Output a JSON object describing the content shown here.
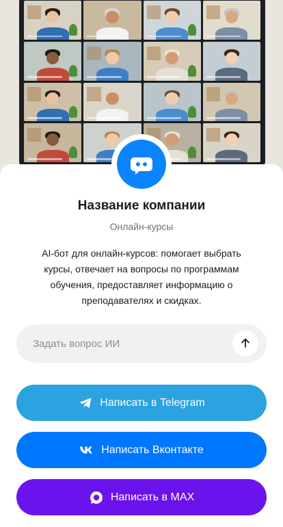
{
  "company": {
    "name": "Название компании",
    "category": "Онлайн-курсы",
    "description": "AI-бот для онлайн-курсов: помогает выбрать курсы, отвечает на вопросы по программам обучения, предоставляет информацию о преподавателях и скидках.",
    "avatar_icon": "chat-bot-icon",
    "avatar_color": "#0a84ff"
  },
  "hero": {
    "image": "video-conference-grid-photo",
    "tiles": 16
  },
  "ask": {
    "placeholder": "Задать вопрос ИИ",
    "value": "",
    "send_icon": "arrow-up-icon"
  },
  "buttons": {
    "telegram": {
      "label": "Написать в Telegram",
      "icon": "telegram-icon",
      "color": "#2aa3e0"
    },
    "vk": {
      "label": "Написать Вконтакте",
      "icon": "vk-icon",
      "color": "#0077ff"
    },
    "max": {
      "label": "Написать в MAX",
      "icon": "max-icon",
      "color": "#6b13ec"
    }
  }
}
